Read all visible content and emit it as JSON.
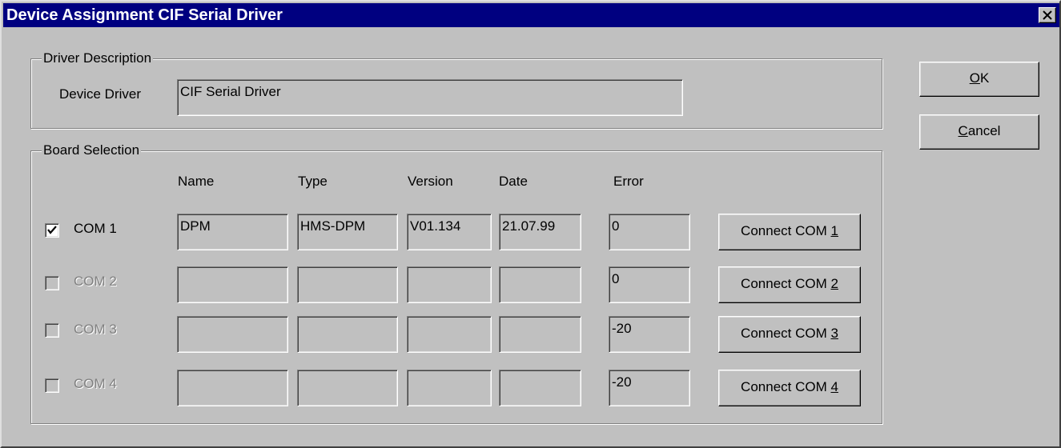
{
  "window": {
    "title": "Device Assignment CIF Serial Driver"
  },
  "driver_description": {
    "group_label": "Driver Description",
    "device_driver_label": "Device Driver",
    "device_driver_value": "CIF Serial Driver"
  },
  "buttons": {
    "ok_label": "OK",
    "ok_mnemonic": "O",
    "ok_rest": "K",
    "cancel_label": "Cancel",
    "cancel_mnemonic": "C",
    "cancel_rest": "ancel"
  },
  "board_selection": {
    "group_label": "Board Selection",
    "columns": {
      "name": "Name",
      "type": "Type",
      "version": "Version",
      "date": "Date",
      "error": "Error"
    },
    "rows": [
      {
        "port": "COM 1",
        "checked": true,
        "enabled": true,
        "name": "DPM",
        "type": "HMS-DPM",
        "version": "V01.134",
        "date": "21.07.99",
        "error": "0",
        "connect_prefix": "Connect COM ",
        "connect_key": "1"
      },
      {
        "port": "COM 2",
        "checked": false,
        "enabled": false,
        "name": "",
        "type": "",
        "version": "",
        "date": "",
        "error": "0",
        "connect_prefix": "Connect COM ",
        "connect_key": "2"
      },
      {
        "port": "COM 3",
        "checked": false,
        "enabled": false,
        "name": "",
        "type": "",
        "version": "",
        "date": "",
        "error": "-20",
        "connect_prefix": "Connect COM ",
        "connect_key": "3"
      },
      {
        "port": "COM 4",
        "checked": false,
        "enabled": false,
        "name": "",
        "type": "",
        "version": "",
        "date": "",
        "error": "-20",
        "connect_prefix": "Connect COM ",
        "connect_key": "4"
      }
    ]
  }
}
